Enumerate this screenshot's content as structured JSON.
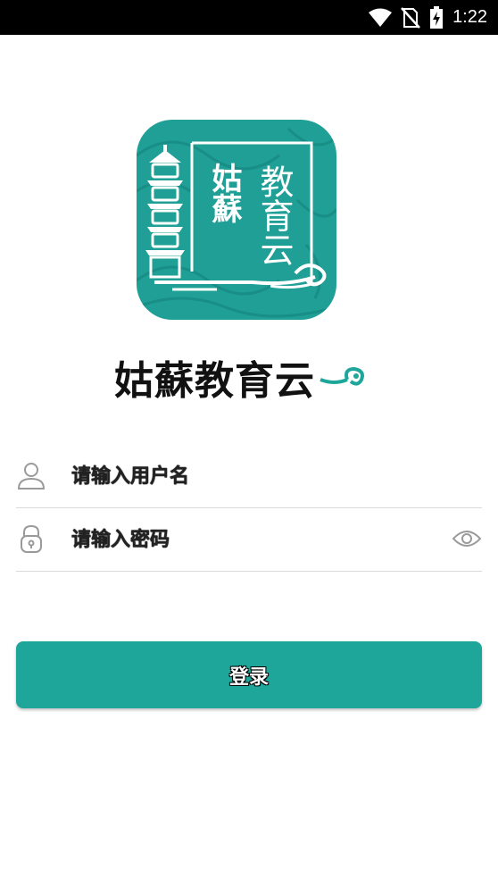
{
  "status_bar": {
    "time": "1:22",
    "icons": [
      "wifi-icon",
      "no-sim-icon",
      "battery-charging-icon"
    ]
  },
  "app": {
    "title": "姑蘇教育云",
    "logo_text_left": "姑蘇",
    "logo_text_right": "教育云",
    "brand_color": "#1fa69a"
  },
  "form": {
    "username_placeholder": "请输入用户名",
    "username_value": "",
    "password_placeholder": "请输入密码",
    "password_value": "",
    "password_icon": "eye-icon",
    "user_icon": "user-icon",
    "lock_icon": "lock-icon"
  },
  "login": {
    "label": "登录"
  }
}
